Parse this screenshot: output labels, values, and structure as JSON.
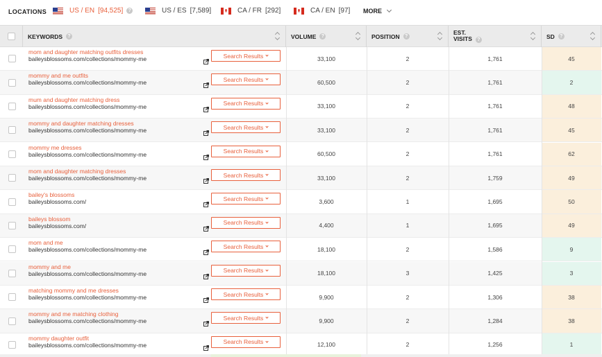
{
  "locations": {
    "title": "LOCATIONS",
    "items": [
      {
        "label": "US / EN",
        "count": "[94,525]",
        "flag": "us-flag-icon",
        "active": true
      },
      {
        "label": "US / ES",
        "count": "[7,589]",
        "flag": "us-flag-icon",
        "active": false
      },
      {
        "label": "CA / FR",
        "count": "[292]",
        "flag": "ca-flag-icon",
        "active": false
      },
      {
        "label": "CA / EN",
        "count": "[97]",
        "flag": "ca-flag-icon",
        "active": false
      }
    ],
    "more_label": "MORE"
  },
  "table": {
    "headers": {
      "keywords": "KEYWORDS",
      "volume": "VOLUME",
      "position": "POSITION",
      "est_visits_1": "EST.",
      "est_visits_2": "VISITS",
      "sd": "SD"
    },
    "search_results_label": "Search Results",
    "rows": [
      {
        "keyword": "mom and daughter matching outfits dresses",
        "url": "baileysblossoms.com/collections/mommy-me",
        "volume": "33,100",
        "position": "2",
        "visits": "1,761",
        "sd": "45"
      },
      {
        "keyword": "mommy and me outfits",
        "url": "baileysblossoms.com/collections/mommy-me",
        "volume": "60,500",
        "position": "2",
        "visits": "1,761",
        "sd": "2"
      },
      {
        "keyword": "mum and daughter matching dress",
        "url": "baileysblossoms.com/collections/mommy-me",
        "volume": "33,100",
        "position": "2",
        "visits": "1,761",
        "sd": "48"
      },
      {
        "keyword": "mommy and daughter matching dresses",
        "url": "baileysblossoms.com/collections/mommy-me",
        "volume": "33,100",
        "position": "2",
        "visits": "1,761",
        "sd": "45"
      },
      {
        "keyword": "mommy me dresses",
        "url": "baileysblossoms.com/collections/mommy-me",
        "volume": "60,500",
        "position": "2",
        "visits": "1,761",
        "sd": "62"
      },
      {
        "keyword": "mom and daughter matching dresses",
        "url": "baileysblossoms.com/collections/mommy-me",
        "volume": "33,100",
        "position": "2",
        "visits": "1,759",
        "sd": "49"
      },
      {
        "keyword": "bailey's blossoms",
        "url": "baileysblossoms.com/",
        "volume": "3,600",
        "position": "1",
        "visits": "1,695",
        "sd": "50"
      },
      {
        "keyword": "baileys blossom",
        "url": "baileysblossoms.com/",
        "volume": "4,400",
        "position": "1",
        "visits": "1,695",
        "sd": "49"
      },
      {
        "keyword": "mom and me",
        "url": "baileysblossoms.com/collections/mommy-me",
        "volume": "18,100",
        "position": "2",
        "visits": "1,586",
        "sd": "9"
      },
      {
        "keyword": "mommy and me",
        "url": "baileysblossoms.com/collections/mommy-me",
        "volume": "18,100",
        "position": "3",
        "visits": "1,425",
        "sd": "3"
      },
      {
        "keyword": "matching mommy and me dresses",
        "url": "baileysblossoms.com/collections/mommy-me",
        "volume": "9,900",
        "position": "2",
        "visits": "1,306",
        "sd": "38"
      },
      {
        "keyword": "mommy and me matching clothing",
        "url": "baileysblossoms.com/collections/mommy-me",
        "volume": "9,900",
        "position": "2",
        "visits": "1,284",
        "sd": "38"
      },
      {
        "keyword": "mommy daughter outfit",
        "url": "baileysblossoms.com/collections/mommy-me",
        "volume": "12,100",
        "position": "2",
        "visits": "1,256",
        "sd": "1"
      }
    ]
  },
  "colors": {
    "accent": "#e8603c",
    "sd_mid": "#fbefdc",
    "sd_low": "#e4f6ee"
  }
}
